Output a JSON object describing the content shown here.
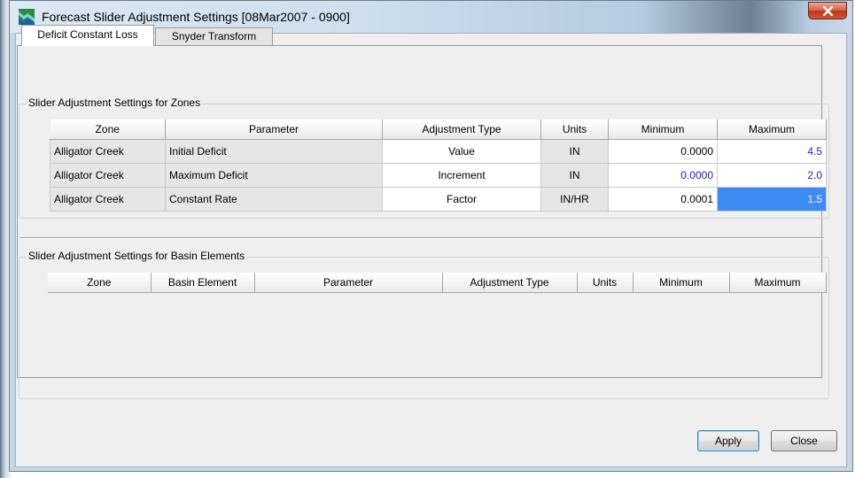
{
  "window": {
    "title": "Forecast Slider Adjustment Settings [08Mar2007 - 0900]"
  },
  "tabs": [
    {
      "label": "Deficit Constant Loss",
      "active": true
    },
    {
      "label": "Snyder Transform",
      "active": false
    }
  ],
  "zones_group": {
    "title": "Slider Adjustment Settings for Zones",
    "columns": [
      "Zone",
      "Parameter",
      "Adjustment Type",
      "Units",
      "Minimum",
      "Maximum"
    ],
    "rows": [
      {
        "zone": "Alligator Creek",
        "parameter": "Initial Deficit",
        "adjustment_type": "Value",
        "units": "IN",
        "minimum": "0.0000",
        "maximum": "4.5"
      },
      {
        "zone": "Alligator Creek",
        "parameter": "Maximum Deficit",
        "adjustment_type": "Increment",
        "units": "IN",
        "minimum": "0.0000",
        "maximum": "2.0"
      },
      {
        "zone": "Alligator Creek",
        "parameter": "Constant Rate",
        "adjustment_type": "Factor",
        "units": "IN/HR",
        "minimum": "0.0001",
        "maximum": "1.5"
      }
    ]
  },
  "basin_group": {
    "title": "Slider Adjustment Settings for Basin Elements",
    "columns": [
      "Zone",
      "Basin Element",
      "Parameter",
      "Adjustment Type",
      "Units",
      "Minimum",
      "Maximum"
    ]
  },
  "buttons": {
    "apply": "Apply",
    "close": "Close"
  },
  "colors": {
    "edited_value_text": "#2020cc",
    "selection_background": "#3d8cf4"
  }
}
